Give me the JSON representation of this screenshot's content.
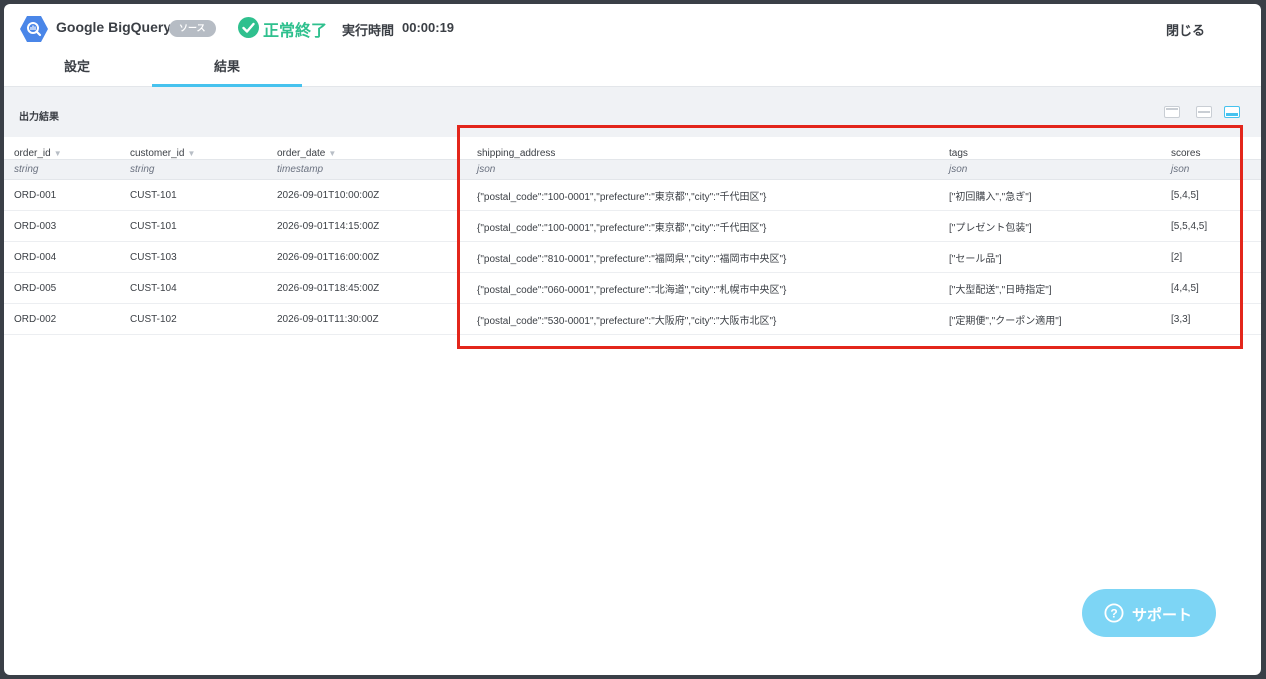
{
  "header": {
    "source_name": "Google BigQuery",
    "badge": "ソース",
    "status": "正常終了",
    "time_label": "実行時間",
    "time_value": "00:00:19",
    "close": "閉じる"
  },
  "tabs": [
    {
      "label": "設定",
      "active": false
    },
    {
      "label": "結果",
      "active": true
    }
  ],
  "section": {
    "title": "出力結果"
  },
  "table": {
    "columns": [
      {
        "name": "order_id",
        "type": "string",
        "sortable": true
      },
      {
        "name": "customer_id",
        "type": "string",
        "sortable": true
      },
      {
        "name": "order_date",
        "type": "timestamp",
        "sortable": true
      },
      {
        "name": "shipping_address",
        "type": "json",
        "sortable": false
      },
      {
        "name": "tags",
        "type": "json",
        "sortable": false
      },
      {
        "name": "scores",
        "type": "json",
        "sortable": false
      }
    ],
    "rows": [
      [
        "ORD-001",
        "CUST-101",
        "2026-09-01T10:00:00Z",
        "{\"postal_code\":\"100-0001\",\"prefecture\":\"東京都\",\"city\":\"千代田区\"}",
        "[\"初回購入\",\"急ぎ\"]",
        "[5,4,5]"
      ],
      [
        "ORD-003",
        "CUST-101",
        "2026-09-01T14:15:00Z",
        "{\"postal_code\":\"100-0001\",\"prefecture\":\"東京都\",\"city\":\"千代田区\"}",
        "[\"プレゼント包装\"]",
        "[5,5,4,5]"
      ],
      [
        "ORD-004",
        "CUST-103",
        "2026-09-01T16:00:00Z",
        "{\"postal_code\":\"810-0001\",\"prefecture\":\"福岡県\",\"city\":\"福岡市中央区\"}",
        "[\"セール品\"]",
        "[2]"
      ],
      [
        "ORD-005",
        "CUST-104",
        "2026-09-01T18:45:00Z",
        "{\"postal_code\":\"060-0001\",\"prefecture\":\"北海道\",\"city\":\"札幌市中央区\"}",
        "[\"大型配送\",\"日時指定\"]",
        "[4,4,5]"
      ],
      [
        "ORD-002",
        "CUST-102",
        "2026-09-01T11:30:00Z",
        "{\"postal_code\":\"530-0001\",\"prefecture\":\"大阪府\",\"city\":\"大阪市北区\"}",
        "[\"定期便\",\"クーポン適用\"]",
        "[3,3]"
      ]
    ]
  },
  "support": {
    "label": "サポート"
  },
  "colors": {
    "accent": "#46c2ee",
    "success": "#2fc08e",
    "highlight": "#e3261b",
    "support_button": "#7dd5f5"
  },
  "icons": {
    "source": "bigquery-icon",
    "status": "check-circle-icon",
    "support": "question-circle-icon",
    "sort": "caret-down-icon"
  }
}
